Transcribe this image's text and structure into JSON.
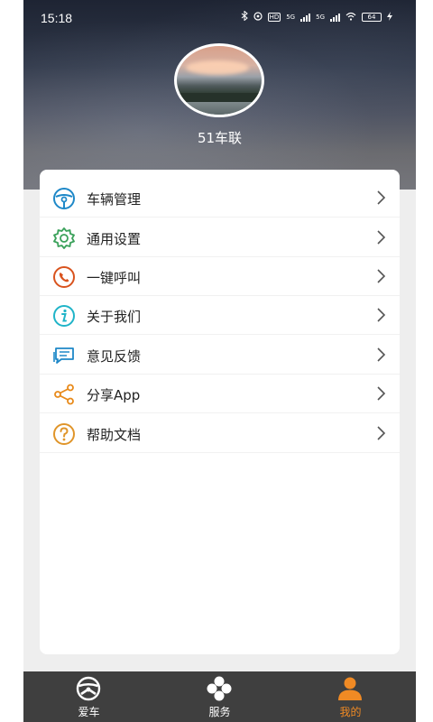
{
  "status_bar": {
    "time": "15:18",
    "network_labels": [
      "5G",
      "5G"
    ],
    "hd_label": "HD",
    "battery": "64"
  },
  "profile": {
    "username": "51车联"
  },
  "menu": {
    "items": [
      {
        "label": "车辆管理",
        "icon": "steering-wheel-icon",
        "color": "#1e88c8"
      },
      {
        "label": "通用设置",
        "icon": "gear-icon",
        "color": "#3aa15a"
      },
      {
        "label": "一键呼叫",
        "icon": "phone-icon",
        "color": "#d9531e"
      },
      {
        "label": "关于我们",
        "icon": "info-icon",
        "color": "#20b4c8"
      },
      {
        "label": "意见反馈",
        "icon": "feedback-icon",
        "color": "#1e88c8"
      },
      {
        "label": "分享App",
        "icon": "share-icon",
        "color": "#e88a1a"
      },
      {
        "label": "帮助文档",
        "icon": "help-icon",
        "color": "#e0952a"
      }
    ]
  },
  "tabbar": {
    "tabs": [
      {
        "label": "爱车",
        "icon": "steering-wheel-icon",
        "active": false
      },
      {
        "label": "服务",
        "icon": "clover-icon",
        "active": false
      },
      {
        "label": "我的",
        "icon": "person-icon",
        "active": true
      }
    ],
    "active_color": "#f08a24"
  }
}
